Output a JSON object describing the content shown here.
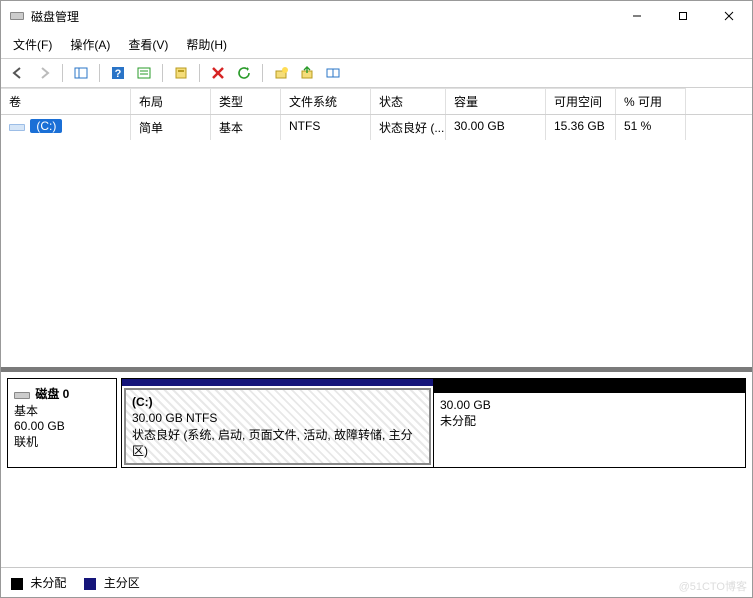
{
  "window": {
    "title": "磁盘管理"
  },
  "menu": {
    "file": "文件(F)",
    "action": "操作(A)",
    "view": "查看(V)",
    "help": "帮助(H)"
  },
  "volume_columns": {
    "volume": "卷",
    "layout": "布局",
    "type": "类型",
    "filesystem": "文件系统",
    "status": "状态",
    "capacity": "容量",
    "free": "可用空间",
    "percent": "% 可用"
  },
  "volumes": [
    {
      "name": "(C:)",
      "layout": "简单",
      "type": "基本",
      "filesystem": "NTFS",
      "status": "状态良好 (...",
      "capacity": "30.00 GB",
      "free": "15.36 GB",
      "percent": "51 %"
    }
  ],
  "disks": [
    {
      "name": "磁盘 0",
      "type": "基本",
      "size": "60.00 GB",
      "status": "联机",
      "partitions": [
        {
          "kind": "primary",
          "label": "(C:)",
          "line2": "30.00 GB NTFS",
          "line3": "状态良好 (系统, 启动, 页面文件, 活动, 故障转储, 主分区)",
          "width_pct": 50
        },
        {
          "kind": "unallocated",
          "label": "",
          "line2": "30.00 GB",
          "line3": "未分配",
          "width_pct": 50
        }
      ]
    }
  ],
  "legend": {
    "unallocated": "未分配",
    "primary": "主分区"
  },
  "watermark": "@51CTO博客"
}
